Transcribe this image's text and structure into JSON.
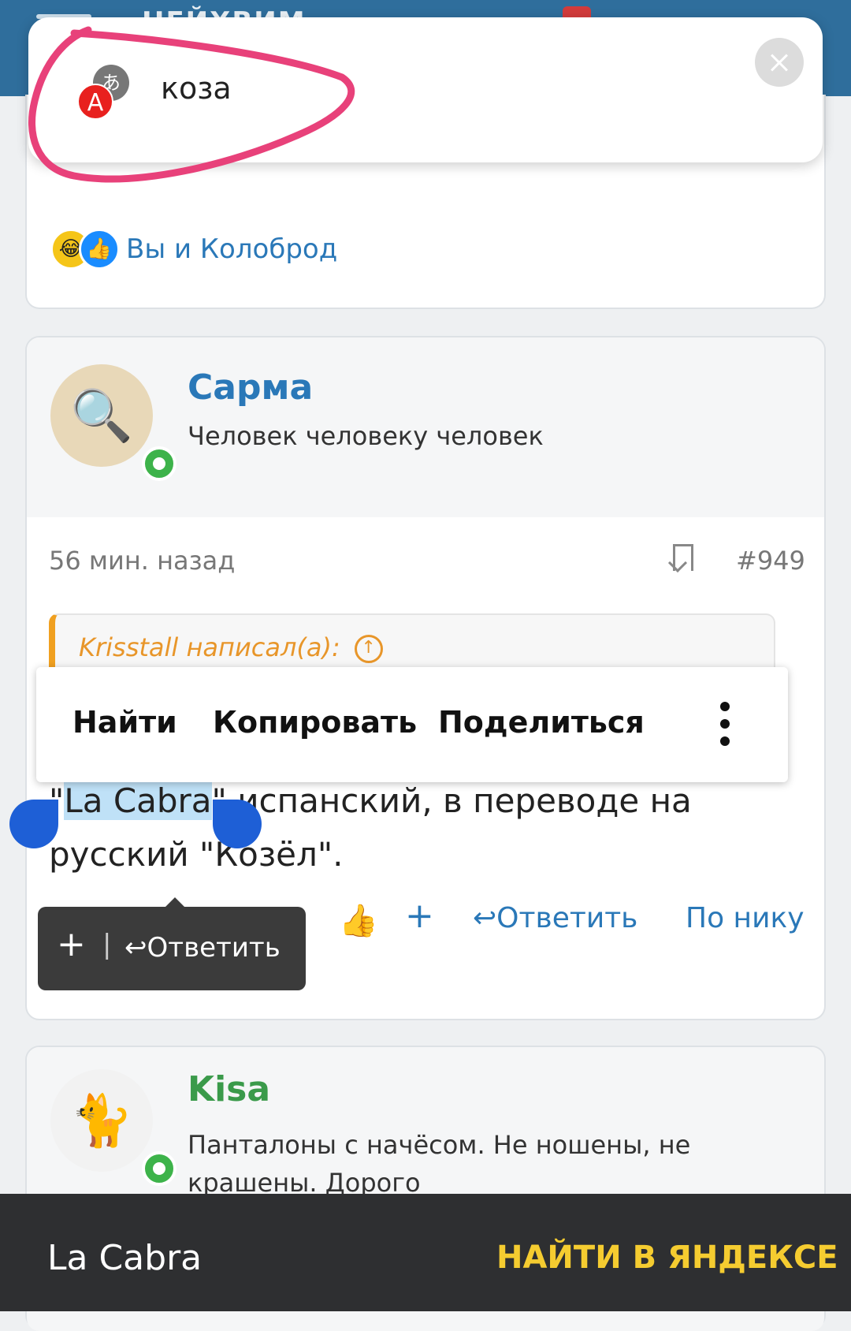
{
  "topbar": {
    "brand": "НЕЙХВИМ"
  },
  "translate_popup": {
    "word": "коза",
    "icon_back": "あ",
    "icon_front": "A"
  },
  "card1": {
    "reactions_text": "Вы и Колоброд",
    "reaction_emojis": [
      "laugh-emoji",
      "like-emoji"
    ]
  },
  "post": {
    "author": "Сарма",
    "author_title": "Человек человеку человек",
    "time": "56 мин. назад",
    "number": "#949",
    "quote_header": "Krisstall написал(а):",
    "text_open_quote": "\"",
    "text_selected": "La Cabra",
    "text_rest_line1": "\" испанский, в переводе на",
    "text_line2": "русский \"Козёл\".",
    "actions": {
      "reply": "Ответить",
      "by_nick": "По нику",
      "plus": "+"
    }
  },
  "context_menu": {
    "find": "Найти",
    "copy": "Копировать",
    "share": "Поделиться"
  },
  "tooltip": {
    "plus": "+",
    "sep": "|",
    "reply": "Ответить"
  },
  "next_post": {
    "author": "Kisa",
    "author_title": "Панталоны с начёсом. Не ношены, не крашены. Дорого"
  },
  "search_bar": {
    "query": "La Cabra",
    "button": "НАЙТИ В ЯНДЕКСЕ"
  },
  "colors": {
    "link": "#2a78b8",
    "accent_orange": "#e8962a",
    "search_button": "#f5cc30",
    "highlight": "#e8417a"
  }
}
